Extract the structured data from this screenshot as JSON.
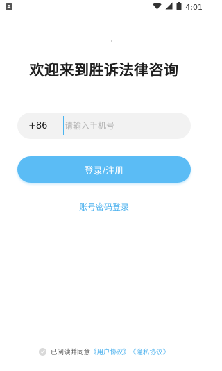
{
  "statusbar": {
    "app_badge": "A",
    "time": "4:01",
    "icons": [
      "wifi-icon",
      "signal-icon",
      "battery-icon"
    ]
  },
  "title": "欢迎来到胜诉法律咨询",
  "phone": {
    "country_code": "+86",
    "placeholder": "请输入手机号",
    "value": ""
  },
  "login_button_label": "登录/注册",
  "alt_login_label": "账号密码登录",
  "agreement": {
    "prefix": "已阅读并同意",
    "user_agreement": "《用户协议》",
    "privacy_agreement": "《隐私协议》",
    "checked": false
  },
  "colors": {
    "accent": "#5bbcf5",
    "link": "#49b0ee",
    "input_bg": "#f2f2f2"
  }
}
